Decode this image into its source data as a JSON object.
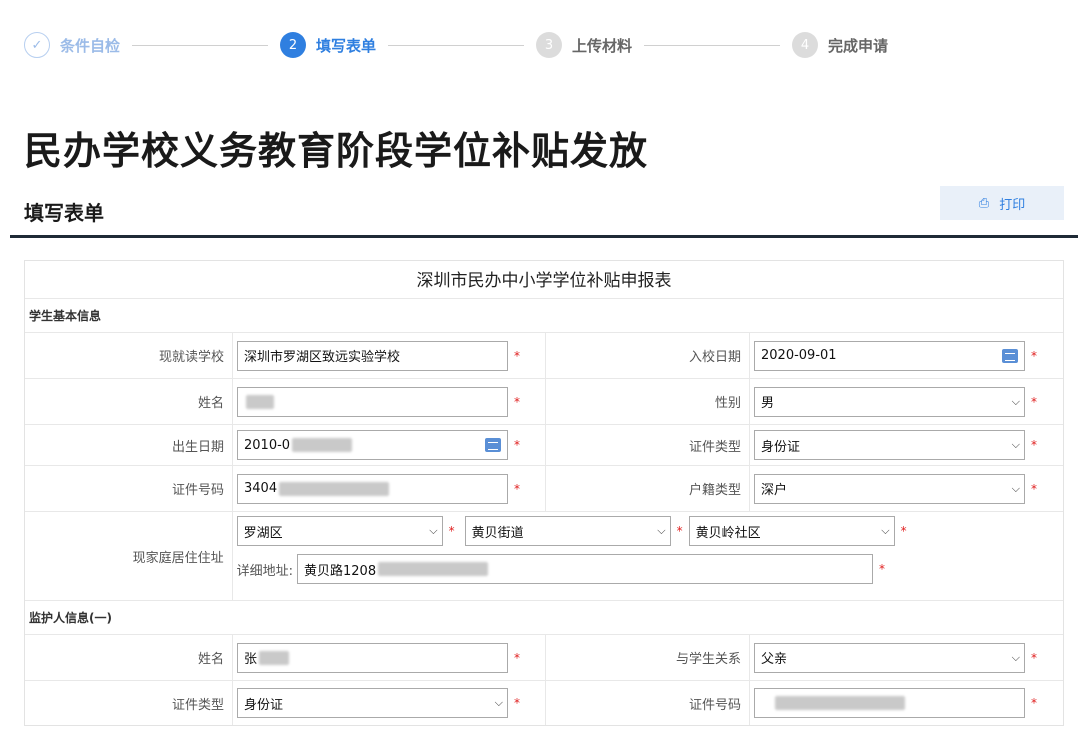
{
  "stepper": {
    "steps": [
      {
        "num": "✓",
        "label": "条件自检",
        "state": "done"
      },
      {
        "num": "2",
        "label": "填写表单",
        "state": "active"
      },
      {
        "num": "3",
        "label": "上传材料",
        "state": "todo"
      },
      {
        "num": "4",
        "label": "完成申请",
        "state": "todo"
      }
    ]
  },
  "page": {
    "title": "民办学校义务教育阶段学位补贴发放",
    "section_title": "填写表单",
    "print_label": "打印",
    "print_icon": "printer-icon"
  },
  "form": {
    "title": "深圳市民办中小学学位补贴申报表",
    "required_mark": "*",
    "student_group": "学生基本信息",
    "school_label": "现就读学校",
    "school_value": "深圳市罗湖区致远实验学校",
    "enroll_label": "入校日期",
    "enroll_value": "2020-09-01",
    "name_label": "姓名",
    "gender_label": "性别",
    "gender_value": "男",
    "birth_label": "出生日期",
    "birth_value": "2010-0",
    "idtype_label": "证件类型",
    "idtype_value": "身份证",
    "idnum_label": "证件号码",
    "idnum_value": "3404",
    "hukou_label": "户籍类型",
    "hukou_value": "深户",
    "address_label": "现家庭居住住址",
    "district_value": "罗湖区",
    "street_value": "黄贝街道",
    "community_value": "黄贝岭社区",
    "detail_label": "详细地址:",
    "detail_value": "黄贝路1208",
    "guardian_group": "监护人信息(一)",
    "g_name_label": "姓名",
    "g_name_value": "张",
    "g_relation_label": "与学生关系",
    "g_relation_value": "父亲",
    "g_idtype_label": "证件类型",
    "g_idtype_value": "身份证",
    "g_idnum_label": "证件号码",
    "g_idnum_value": ""
  },
  "colors": {
    "accent": "#2f7fe0",
    "required": "#e02020",
    "done": "#9bbbe8"
  }
}
